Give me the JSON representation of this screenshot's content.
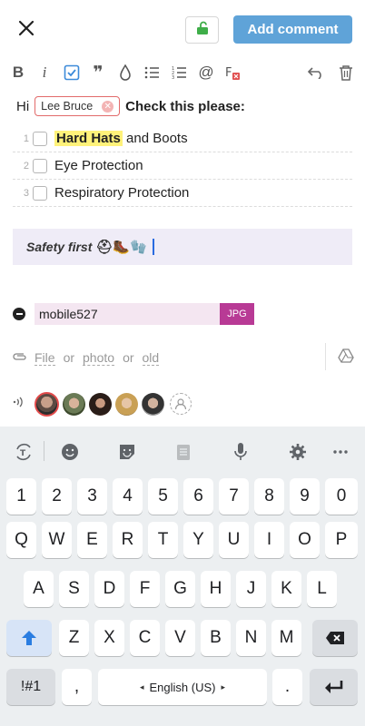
{
  "topbar": {
    "add_comment_label": "Add comment"
  },
  "editor": {
    "greeting": "Hi",
    "mention": "Lee Bruce",
    "request": "Check this please:",
    "checklist": [
      {
        "num": "1",
        "highlight": "Hard Hats",
        "rest": " and Boots"
      },
      {
        "num": "2",
        "highlight": "",
        "rest": "Eye Protection"
      },
      {
        "num": "3",
        "highlight": "",
        "rest": "Respiratory Protection"
      }
    ],
    "quote": "Safety first",
    "quote_emoji": "⛑🥾🧤"
  },
  "attachment": {
    "name": "mobile527",
    "ext": "JPG"
  },
  "attach_links": {
    "file": "File",
    "or1": "or",
    "photo": "photo",
    "or2": "or",
    "old": "old"
  },
  "keyboard": {
    "row_numbers": [
      "1",
      "2",
      "3",
      "4",
      "5",
      "6",
      "7",
      "8",
      "9",
      "0"
    ],
    "row1": [
      "Q",
      "W",
      "E",
      "R",
      "T",
      "Y",
      "U",
      "I",
      "O",
      "P"
    ],
    "row2": [
      "A",
      "S",
      "D",
      "F",
      "G",
      "H",
      "J",
      "K",
      "L"
    ],
    "row3": [
      "Z",
      "X",
      "C",
      "V",
      "B",
      "N",
      "M"
    ],
    "symbols": "!#1",
    "comma": ",",
    "space_label": "English (US)",
    "period": "."
  },
  "colors": {
    "accent": "#5fa3d8",
    "mention_border": "#e26a6a",
    "file_ext": "#b83a95",
    "highlight": "#fff27a"
  }
}
